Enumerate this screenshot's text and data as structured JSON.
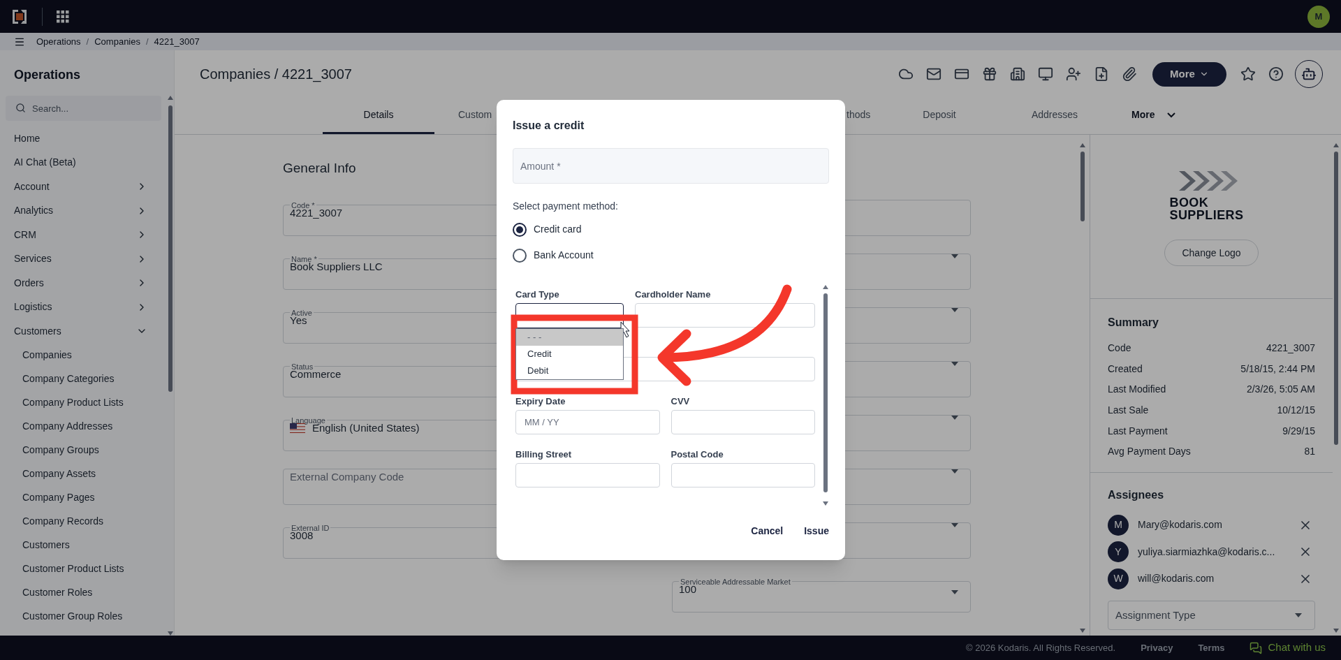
{
  "top_bar": {
    "avatar": "M"
  },
  "breadcrumb": {
    "separator": "/",
    "items": [
      "Operations",
      "Companies",
      "4221_3007"
    ]
  },
  "sidebar": {
    "title": "Operations",
    "search": {
      "placeholder": "Search..."
    },
    "items": [
      {
        "label": "Home",
        "kind": "link"
      },
      {
        "label": "AI Chat (Beta)",
        "kind": "link"
      },
      {
        "label": "Account",
        "kind": "group",
        "expanded": false
      },
      {
        "label": "Analytics",
        "kind": "group",
        "expanded": false
      },
      {
        "label": "CRM",
        "kind": "group",
        "expanded": false
      },
      {
        "label": "Services",
        "kind": "group",
        "expanded": false
      },
      {
        "label": "Orders",
        "kind": "group",
        "expanded": false
      },
      {
        "label": "Logistics",
        "kind": "group",
        "expanded": false
      },
      {
        "label": "Customers",
        "kind": "group",
        "expanded": true,
        "children": [
          {
            "label": "Companies"
          },
          {
            "label": "Company Categories"
          },
          {
            "label": "Company Product Lists"
          },
          {
            "label": "Company Addresses"
          },
          {
            "label": "Company Groups"
          },
          {
            "label": "Company Assets"
          },
          {
            "label": "Company Pages"
          },
          {
            "label": "Company Records"
          },
          {
            "label": "Customers"
          },
          {
            "label": "Customer Product Lists"
          },
          {
            "label": "Customer Roles"
          },
          {
            "label": "Customer Group Roles"
          }
        ]
      }
    ]
  },
  "page": {
    "title": "Companies / 4221_3007",
    "more_button": "More",
    "tabs": [
      {
        "label": "Details",
        "selected": true,
        "kind": "tab"
      },
      {
        "label": "Custom",
        "selected": false,
        "kind": "tab"
      },
      {
        "label": "thods",
        "selected": false,
        "kind": "tab"
      },
      {
        "label": "Deposit",
        "selected": false,
        "kind": "tab"
      },
      {
        "label": "Addresses",
        "selected": false,
        "kind": "tab"
      },
      {
        "label": "More",
        "selected": false,
        "kind": "menu"
      }
    ]
  },
  "form": {
    "section_title": "General Info",
    "left_fields": [
      {
        "kind": "text",
        "label": "Code *",
        "value": "4221_3007"
      },
      {
        "kind": "text",
        "label": "Name *",
        "value": "Book Suppliers LLC"
      },
      {
        "kind": "text",
        "label": "Active",
        "value": "Yes"
      },
      {
        "kind": "text",
        "label": "Status",
        "value": "Commerce"
      },
      {
        "kind": "language",
        "label": "Language",
        "value": "English (United States)"
      },
      {
        "kind": "text",
        "placeholder": "External Company Code"
      },
      {
        "kind": "text",
        "label": "External ID",
        "value": "3008"
      }
    ],
    "right_fields": [
      {
        "kind": "text"
      },
      {
        "kind": "select"
      },
      {
        "kind": "select"
      },
      {
        "kind": "select"
      },
      {
        "kind": "select"
      },
      {
        "kind": "select"
      },
      {
        "kind": "select"
      },
      {
        "kind": "select",
        "label": "Serviceable Addressable Market",
        "value": "100"
      }
    ]
  },
  "profile": {
    "logo": [
      "BOOK",
      "SUPPLIERS"
    ],
    "change_logo": "Change Logo",
    "summary": {
      "title": "Summary",
      "rows": [
        {
          "label": "Code",
          "value": "4221_3007"
        },
        {
          "label": "Created",
          "value": "5/18/15, 2:44 PM"
        },
        {
          "label": "Last Modified",
          "value": "2/3/26, 5:05 AM"
        },
        {
          "label": "Last Sale",
          "value": "10/12/15"
        },
        {
          "label": "Last Payment",
          "value": "9/29/15"
        },
        {
          "label": "Avg Payment Days",
          "value": "81"
        }
      ]
    },
    "assignees": {
      "title": "Assignees",
      "people": [
        {
          "initial": "M",
          "email": "Mary@kodaris.com"
        },
        {
          "initial": "Y",
          "email": "yuliya.siarmiazhka@kodaris.c..."
        },
        {
          "initial": "W",
          "email": "will@kodaris.com"
        }
      ],
      "assignment_type": {
        "placeholder": "Assignment Type"
      }
    }
  },
  "footer": {
    "copyright": "© 2026 Kodaris. All Rights Reserved.",
    "links": [
      "Privacy",
      "Terms"
    ],
    "chat": "Chat with us"
  },
  "dialog": {
    "title": "Issue a credit",
    "amount": {
      "placeholder": "Amount *"
    },
    "payment_label": "Select payment method:",
    "methods": [
      {
        "label": "Credit card",
        "selected": true
      },
      {
        "label": "Bank Account",
        "selected": false
      }
    ],
    "card_type": {
      "label": "Card Type",
      "expanded": true,
      "options": [
        {
          "label": "- - -",
          "selected": true
        },
        {
          "label": "Credit",
          "selected": false
        },
        {
          "label": "Debit",
          "selected": false
        }
      ]
    },
    "cardholder_name": {
      "label": "Cardholder Name"
    },
    "expiry": {
      "label": "Expiry Date",
      "placeholder": "MM / YY"
    },
    "cvv": {
      "label": "CVV"
    },
    "billing_street": {
      "label": "Billing Street"
    },
    "postal_code": {
      "label": "Postal Code"
    },
    "buttons": [
      "Cancel",
      "Issue"
    ]
  }
}
